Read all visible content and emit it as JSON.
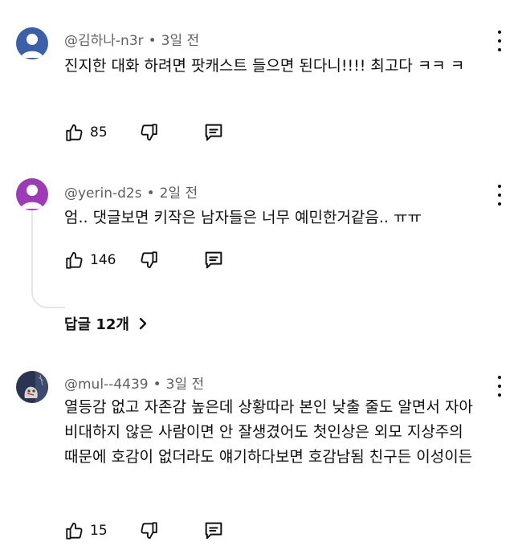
{
  "comments": [
    {
      "author": "@김하나-n3r",
      "time": "3일 전",
      "text": "진지한 대화 하려면 팟캐스트 들으면 된다니!!!! 최고다 ㅋㅋ ㅋ",
      "likes": "85",
      "avatar_color": "#3b5fa8"
    },
    {
      "author": "@yerin-d2s",
      "time": "2일 전",
      "text": "엄.. 댓글보면 키작은 남자들은 너무 예민한거같음.. ㅠㅠ",
      "likes": "146",
      "avatar_color": "#9c3bb5",
      "replies_label": "답글 12개"
    },
    {
      "author": "@mul--4439",
      "time": "3일 전",
      "text": "열등감 없고 자존감 높은데 상황따라 본인 낮출 줄도 알면서 자아 비대하지 않은 사람이면 안 잘생겼어도 첫인상은 외모 지상주의 때문에 호감이 없더라도 얘기하다보면 호감남됨 친구든 이성이든",
      "likes": "15",
      "avatar_color": "#2a3350"
    }
  ],
  "icons": {
    "like": "thumb-up-icon",
    "dislike": "thumb-down-icon",
    "reply": "reply-icon",
    "more": "more-vert-icon",
    "chevron": "chevron-right-icon"
  }
}
